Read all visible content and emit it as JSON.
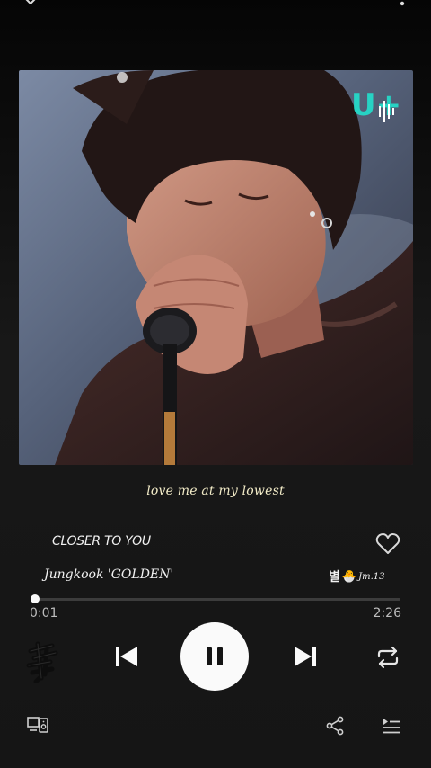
{
  "topbar": {
    "collapse_icon": "chevron-down-icon",
    "more_icon": "more-vertical-icon"
  },
  "artwork": {
    "watermark": "U+"
  },
  "lyric": {
    "text": "love me at my lowest"
  },
  "track": {
    "title": "CLOSER TO YOU",
    "artist": "Jungkook 'GOLDEN'",
    "liked": false,
    "sticker": {
      "hangul": "별",
      "emoji": "🐣",
      "tag": "Jm.13"
    }
  },
  "playback": {
    "elapsed": "0:01",
    "duration": "2:26",
    "progress_fraction": 0.007,
    "state": "playing"
  },
  "controls": {
    "previous_icon": "skip-previous-icon",
    "pause_icon": "pause-icon",
    "next_icon": "skip-next-icon",
    "repeat_icon": "repeat-icon"
  },
  "bottom": {
    "devices_icon": "devices-icon",
    "share_icon": "share-icon",
    "queue_icon": "queue-icon"
  },
  "colors": {
    "background": "#151515",
    "accent": "#fafafa",
    "lyric": "#f3ecc8",
    "watermark": "#27d3c4"
  }
}
